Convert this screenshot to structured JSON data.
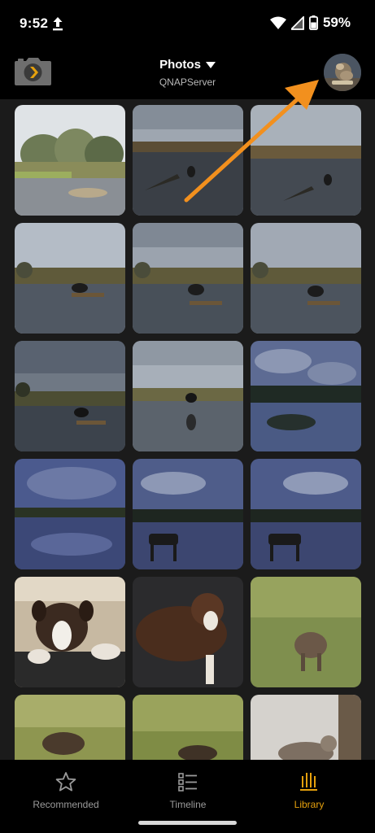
{
  "status_bar": {
    "time": "9:52",
    "battery": "59%",
    "icons": [
      "upload-icon",
      "wifi-icon",
      "signal-icon",
      "battery-icon"
    ]
  },
  "header": {
    "title": "Photos",
    "subtitle": "QNAPServer",
    "logo_icon": "plex-camera-logo",
    "dropdown_icon": "caret-down-icon",
    "avatar": "user-avatar"
  },
  "photos": [
    "Tree-lined pond shore",
    "Dog wading in lake at dusk",
    "Dog wading in lake",
    "Dog standing on log in lake",
    "Dog standing on log in lake",
    "Dog standing on log in lake",
    "Dog on log under cloudy sky",
    "Dog wading in calm water",
    "Lake reflection at dusk",
    "Cloudy sky over lake",
    "Dog on lakeshore at dusk",
    "Dog on lakeshore at dusk",
    "Boxer dog resting head",
    "Boxer dog lying on couch",
    "Dog in tall grass",
    "Dog in grassy field",
    "Dog in grassy field",
    "Dog by white wall"
  ],
  "bottom_nav": {
    "items": [
      {
        "label": "Recommended",
        "icon": "star-icon"
      },
      {
        "label": "Timeline",
        "icon": "timeline-list-icon"
      },
      {
        "label": "Library",
        "icon": "library-icon"
      }
    ],
    "active": "Library"
  },
  "colors": {
    "accent": "#e5a00d",
    "annotation_arrow": "#f2901e",
    "background": "#000000",
    "grid_background": "#1b1b1b"
  }
}
